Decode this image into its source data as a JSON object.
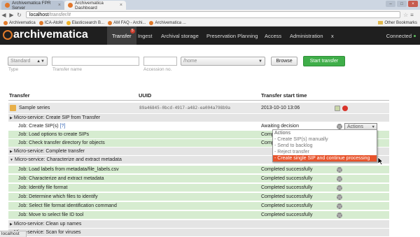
{
  "browser": {
    "tabs": [
      {
        "label": "Archivematica FPR Server"
      },
      {
        "label": "Archivematica Dashboard"
      }
    ],
    "url_host": "localhost",
    "url_path": "/transfer/#",
    "bookmarks": [
      "Archivematica",
      "ICA-AtoM",
      "Elasticsearch B...",
      "AM FAQ - Archi...",
      "Archivematica ..."
    ],
    "other_bookmarks": "Other Bookmarks",
    "status": "localhost"
  },
  "app": {
    "logo": "archivematica",
    "nav": [
      "Transfer",
      "Ingest",
      "Archival storage",
      "Preservation Planning",
      "Access",
      "Administration",
      "x"
    ],
    "transfer_badge": "5",
    "connected": "Connected"
  },
  "form": {
    "type_value": "Standard",
    "type_hint": "Type",
    "name_hint": "Transfer name",
    "accession_hint": "Accession no.",
    "path_value": "/home",
    "browse_label": "Browse",
    "start_label": "Start transfer"
  },
  "table": {
    "headers": {
      "transfer": "Transfer",
      "uuid": "UUID",
      "start": "Transfer start time"
    },
    "transfer_name": "Sample series",
    "transfer_uuid": "89a46845-0bcd-4917-a482-ea004a798b9a",
    "transfer_time": "2013-10-10 13:06",
    "rows": [
      {
        "kind": "ms",
        "label": "Micro-service: Create SIP from Transfer"
      },
      {
        "kind": "job",
        "color": "white",
        "label": "Job: Create SIP(s)",
        "status": "Awaiting decision"
      },
      {
        "kind": "job",
        "color": "green",
        "label": "Job: Load options to create SIPs",
        "status": "Complete"
      },
      {
        "kind": "job",
        "color": "green",
        "label": "Job: Check transfer directory for objects",
        "status": "Complete"
      },
      {
        "kind": "ms",
        "label": "Micro-service: Complete transfer"
      },
      {
        "kind": "ms",
        "label": "Micro-service: Characterize and extract metadata"
      },
      {
        "kind": "job",
        "color": "green",
        "label": "Job: Load labels from metadata/file_labels.csv",
        "status": "Completed successfully"
      },
      {
        "kind": "job",
        "color": "green",
        "label": "Job: Characterize and extract metadata",
        "status": "Completed successfully"
      },
      {
        "kind": "job",
        "color": "green",
        "label": "Job: Identify file format",
        "status": "Completed successfully"
      },
      {
        "kind": "job",
        "color": "green",
        "label": "Job: Determine which files to identify",
        "status": "Completed successfully"
      },
      {
        "kind": "job",
        "color": "green",
        "label": "Job: Select file format identification command",
        "status": "Completed successfully"
      },
      {
        "kind": "job",
        "color": "green",
        "label": "Job: Move to select file ID tool",
        "status": "Completed successfully"
      },
      {
        "kind": "ms",
        "label": "Micro-service: Clean up names"
      },
      {
        "kind": "ms",
        "label": "Micro-service: Scan for viruses"
      }
    ],
    "help_link": "[?]"
  },
  "actions": {
    "select_label": "Actions",
    "options": [
      "Actions",
      "- Create SIP(s) manually",
      "- Send to backlog",
      "- Reject transfer",
      "- Create single SIP and continue processing"
    ]
  }
}
